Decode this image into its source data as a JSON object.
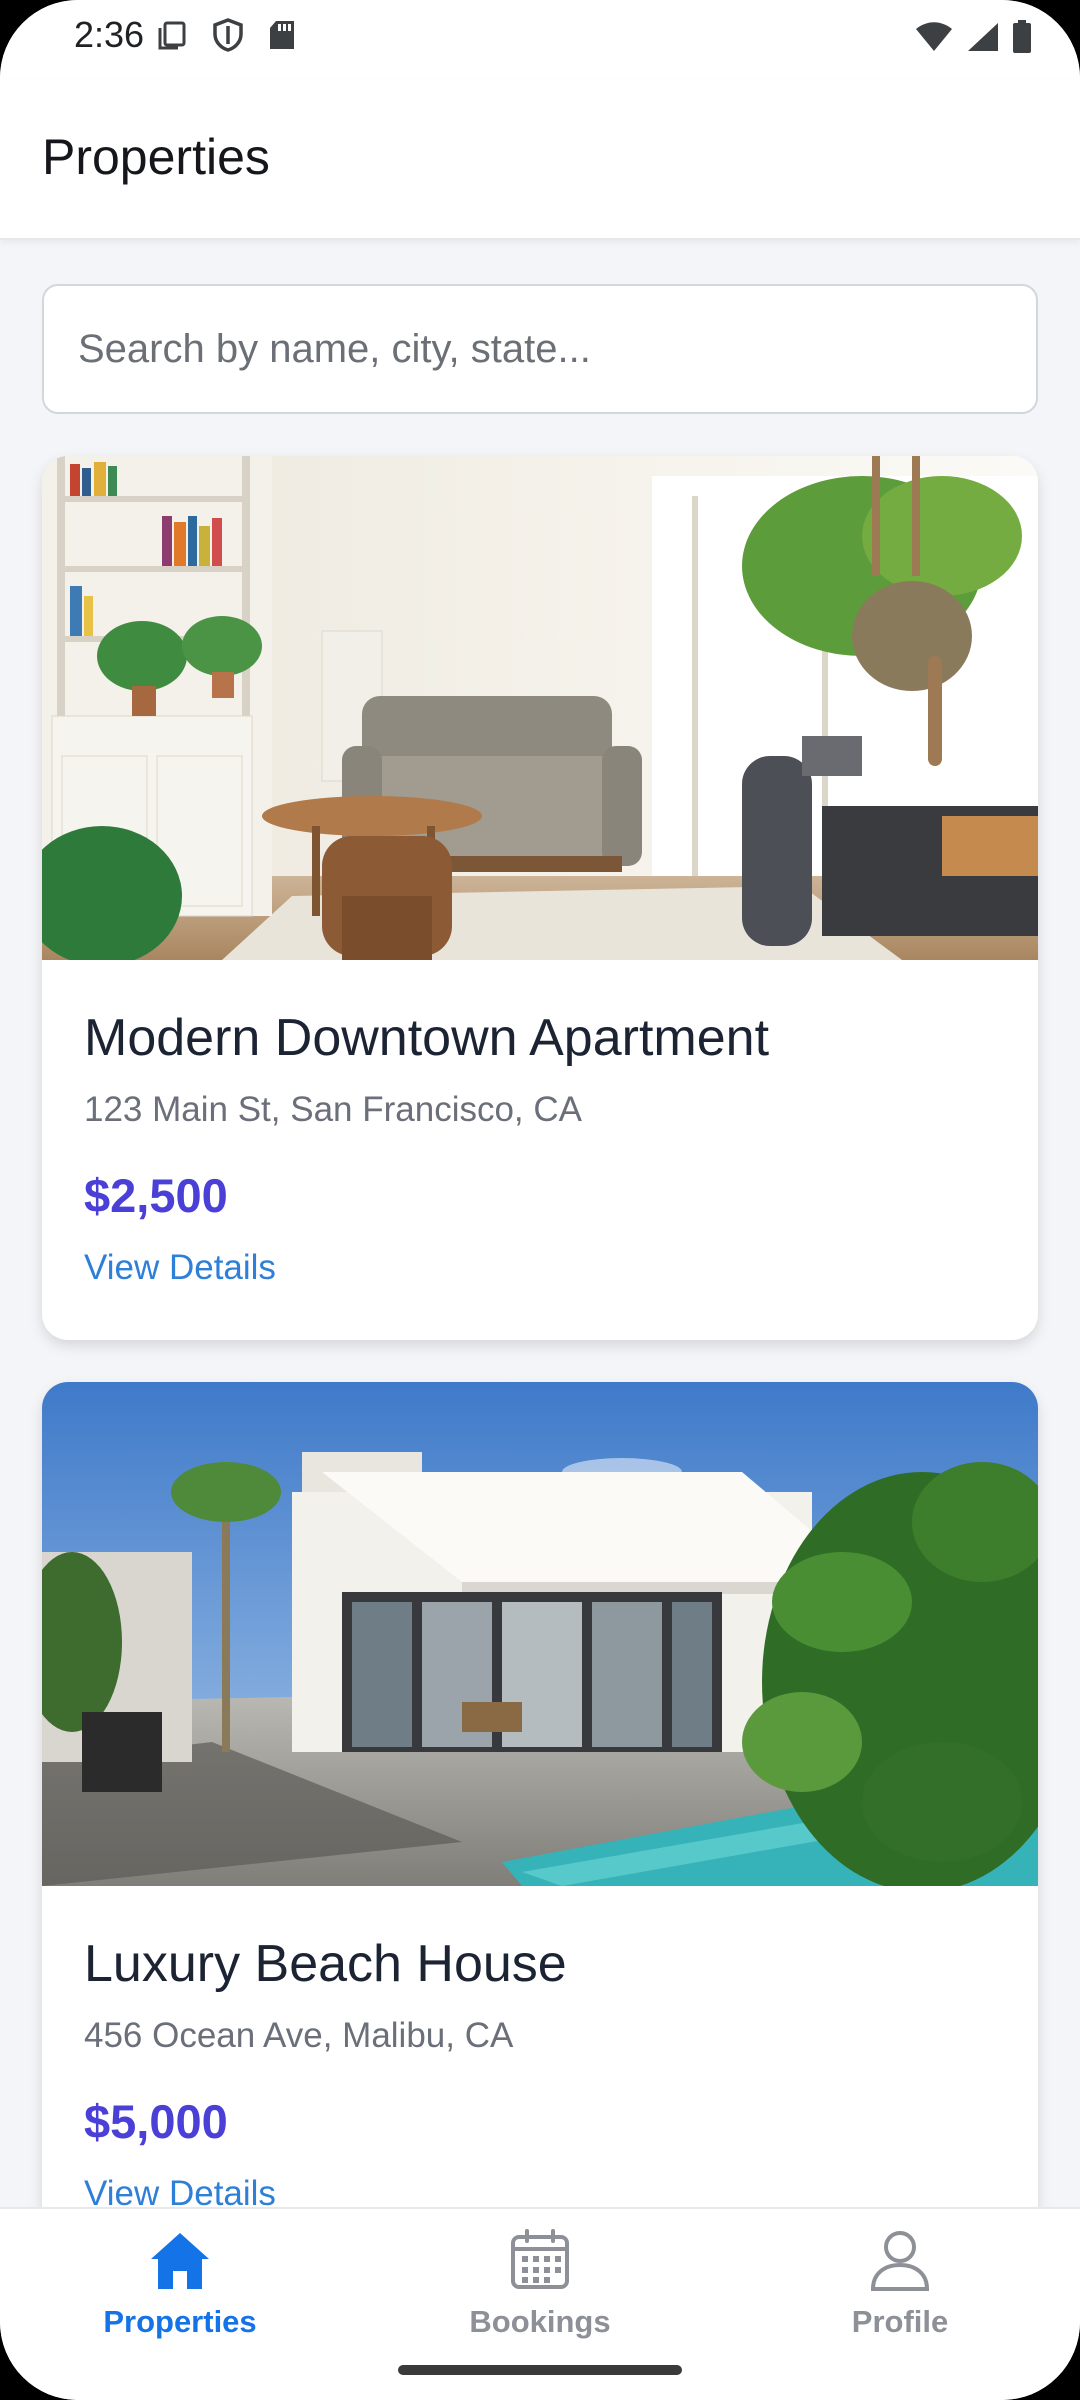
{
  "status_bar": {
    "time": "2:36",
    "left_icons": [
      "copy-icon",
      "shield-icon",
      "sd-card-icon"
    ],
    "right_icons": [
      "wifi-icon",
      "signal-icon",
      "battery-icon"
    ]
  },
  "app_bar": {
    "title": "Properties"
  },
  "search": {
    "placeholder": "Search by name, city, state...",
    "value": ""
  },
  "properties": [
    {
      "image": "living-room-photo",
      "title": "Modern Downtown Apartment",
      "address": "123 Main St, San Francisco, CA",
      "price": "$2,500",
      "link": "View Details"
    },
    {
      "image": "beach-house-photo",
      "title": "Luxury Beach House",
      "address": "456 Ocean Ave, Malibu, CA",
      "price": "$5,000",
      "link": "View Details"
    }
  ],
  "bottom_nav": {
    "items": [
      {
        "label": "Properties",
        "icon": "home-icon",
        "active": true
      },
      {
        "label": "Bookings",
        "icon": "calendar-icon",
        "active": false
      },
      {
        "label": "Profile",
        "icon": "person-icon",
        "active": false
      }
    ]
  },
  "colors": {
    "accent": "#1473e6",
    "price": "#4a3fd6",
    "link": "#2e7fd8",
    "inactive_nav": "#8d9096"
  }
}
